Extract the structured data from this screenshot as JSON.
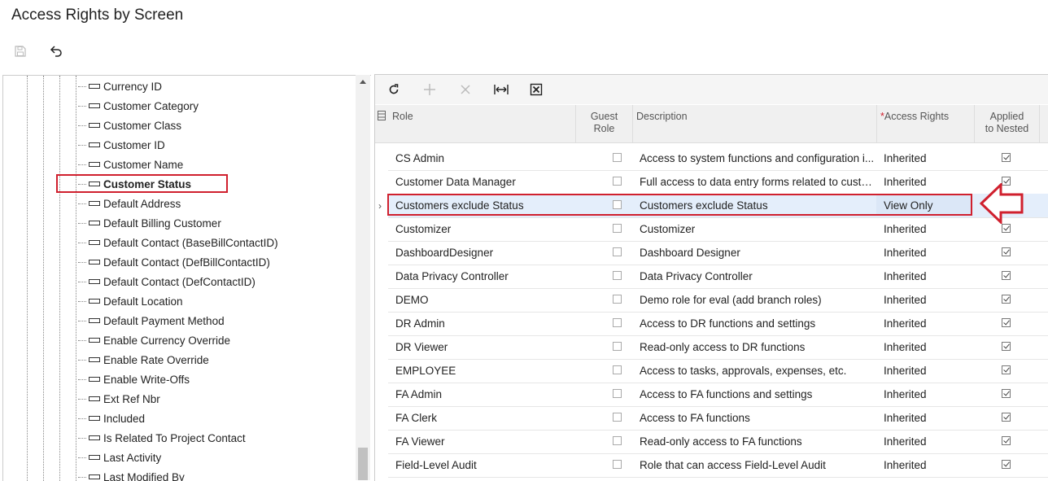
{
  "page": {
    "title": "Access Rights by Screen"
  },
  "toolbar": {
    "save_icon": "save-icon",
    "undo_icon": "undo-icon"
  },
  "tree": {
    "items": [
      {
        "label": "Currency ID"
      },
      {
        "label": "Customer Category"
      },
      {
        "label": "Customer Class"
      },
      {
        "label": "Customer ID"
      },
      {
        "label": "Customer Name"
      },
      {
        "label": "Customer Status"
      },
      {
        "label": "Default Address"
      },
      {
        "label": "Default Billing Customer"
      },
      {
        "label": "Default Contact (BaseBillContactID)"
      },
      {
        "label": "Default Contact (DefBillContactID)"
      },
      {
        "label": "Default Contact (DefContactID)"
      },
      {
        "label": "Default Location"
      },
      {
        "label": "Default Payment Method"
      },
      {
        "label": "Enable Currency Override"
      },
      {
        "label": "Enable Rate Override"
      },
      {
        "label": "Enable Write-Offs"
      },
      {
        "label": "Ext Ref Nbr"
      },
      {
        "label": "Included"
      },
      {
        "label": "Is Related To Project Contact"
      },
      {
        "label": "Last Activity"
      },
      {
        "label": "Last Modified By"
      }
    ],
    "selected_index": 5
  },
  "grid": {
    "toolbar_icons": [
      "refresh-icon",
      "add-icon",
      "delete-icon",
      "fit-columns-icon",
      "export-excel-icon"
    ],
    "columns": {
      "role": "Role",
      "guest_role_1": "Guest",
      "guest_role_2": "Role",
      "description": "Description",
      "required_mark": "*",
      "access_rights": "Access Rights",
      "applied_1": "Applied",
      "applied_2": "to Nested"
    },
    "rows": [
      {
        "role": "CS Admin",
        "guest": false,
        "description": "Access to system functions and configuration i...",
        "access": "Inherited",
        "nested": true
      },
      {
        "role": "Customer Data Manager",
        "guest": false,
        "description": "Full access to data entry forms related to custo...",
        "access": "Inherited",
        "nested": true
      },
      {
        "role": "Customers exclude Status",
        "guest": false,
        "description": "Customers exclude Status",
        "access": "View Only",
        "nested": true
      },
      {
        "role": "Customizer",
        "guest": false,
        "description": "Customizer",
        "access": "Inherited",
        "nested": true
      },
      {
        "role": "DashboardDesigner",
        "guest": false,
        "description": "Dashboard Designer",
        "access": "Inherited",
        "nested": true
      },
      {
        "role": "Data Privacy Controller",
        "guest": false,
        "description": "Data Privacy Controller",
        "access": "Inherited",
        "nested": true
      },
      {
        "role": "DEMO",
        "guest": false,
        "description": "Demo role for eval (add branch roles)",
        "access": "Inherited",
        "nested": true
      },
      {
        "role": "DR Admin",
        "guest": false,
        "description": "Access to DR functions and settings",
        "access": "Inherited",
        "nested": true
      },
      {
        "role": "DR Viewer",
        "guest": false,
        "description": "Read-only access to DR functions",
        "access": "Inherited",
        "nested": true
      },
      {
        "role": "EMPLOYEE",
        "guest": false,
        "description": "Access to tasks, approvals, expenses, etc.",
        "access": "Inherited",
        "nested": true
      },
      {
        "role": "FA Admin",
        "guest": false,
        "description": "Access to FA functions and settings",
        "access": "Inherited",
        "nested": true
      },
      {
        "role": "FA Clerk",
        "guest": false,
        "description": "Access to FA functions",
        "access": "Inherited",
        "nested": true
      },
      {
        "role": "FA Viewer",
        "guest": false,
        "description": "Read-only access to FA functions",
        "access": "Inherited",
        "nested": true
      },
      {
        "role": "Field-Level Audit",
        "guest": false,
        "description": "Role that can access Field-Level Audit",
        "access": "Inherited",
        "nested": true
      }
    ],
    "active_row_index": 2
  },
  "colors": {
    "highlight": "#d0202e",
    "active_row": "#e4eefb"
  }
}
